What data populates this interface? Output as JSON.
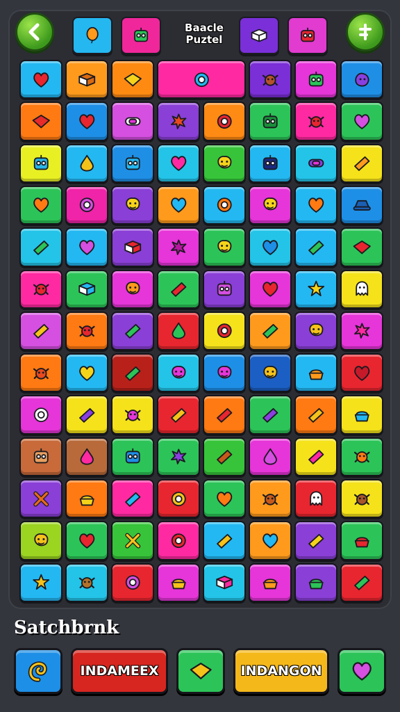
{
  "header": {
    "title_line1": "Baacle",
    "title_line2": "Puztel",
    "back_icon": "back-arrow-icon",
    "menu_icon": "cross-menu-icon",
    "top_tiles": [
      {
        "color": "#25b7f0",
        "icon": "balloon"
      },
      {
        "color": "#f0279a",
        "icon": "robot"
      },
      {
        "color": "#7a2fd8",
        "icon": "book"
      },
      {
        "color": "#e13bd0",
        "icon": "robot"
      }
    ]
  },
  "board": {
    "tiles": [
      {
        "color": "#23b8f2",
        "icon": "heart",
        "fill": "#e8262f"
      },
      {
        "color": "#ff9a1c",
        "icon": "book",
        "fill": "#d86a12"
      },
      {
        "color": "#ff8a12",
        "icon": "diamond",
        "fill": "#f5d31a"
      },
      {
        "color": "#ff2aa1",
        "icon": "ring",
        "fill": "#23b8f2",
        "wide": true
      },
      {
        "color": "#7b2fd6",
        "icon": "crab",
        "fill": "#b5522c"
      },
      {
        "color": "#e635d8",
        "icon": "robot",
        "fill": "#2cc458"
      },
      {
        "color": "#1f8fe6",
        "icon": "blob",
        "fill": "#8a3fe0"
      },
      {
        "color": "#ff7a12",
        "icon": "diamond",
        "fill": "#e82a2a"
      },
      {
        "color": "#1e8fe6",
        "icon": "heart",
        "fill": "#e8262f"
      },
      {
        "color": "#d54fe0",
        "icon": "candy",
        "fill": "#ffffff"
      },
      {
        "color": "#8a3fd6",
        "icon": "flower",
        "fill": "#e84a1e"
      },
      {
        "color": "#ff8a14",
        "icon": "ring",
        "fill": "#e8262f"
      },
      {
        "color": "#2cc458",
        "icon": "robot",
        "fill": "#1a8f3a"
      },
      {
        "color": "#ff2aa1",
        "icon": "crab",
        "fill": "#e8262f"
      },
      {
        "color": "#2cc458",
        "icon": "heart",
        "fill": "#d54fe0"
      },
      {
        "color": "#e8f024",
        "icon": "robot",
        "fill": "#29b6e8"
      },
      {
        "color": "#23b8f2",
        "icon": "drop",
        "fill": "#f5c21a"
      },
      {
        "color": "#1f8fe6",
        "icon": "robot",
        "fill": "#23b8f2"
      },
      {
        "color": "#23c4e8",
        "icon": "heart",
        "fill": "#ff2aa1"
      },
      {
        "color": "#37c43a",
        "icon": "smile",
        "fill": "#f5d31a"
      },
      {
        "color": "#23b8f2",
        "icon": "robot",
        "fill": "#1a2a80"
      },
      {
        "color": "#23c4e8",
        "icon": "candy",
        "fill": "#8a3fe0"
      },
      {
        "color": "#f5e21a",
        "icon": "bar",
        "fill": "#ff9a1c"
      },
      {
        "color": "#2cc458",
        "icon": "heart",
        "fill": "#ff7a12"
      },
      {
        "color": "#f024a8",
        "icon": "ring",
        "fill": "#d54fe0"
      },
      {
        "color": "#8a3fd6",
        "icon": "smile",
        "fill": "#f5d31a"
      },
      {
        "color": "#ff9a1c",
        "icon": "heart",
        "fill": "#23b8f2"
      },
      {
        "color": "#23b8f2",
        "icon": "ring",
        "fill": "#ff7a12"
      },
      {
        "color": "#e635d8",
        "icon": "smile",
        "fill": "#f5d31a"
      },
      {
        "color": "#23b8f2",
        "icon": "heart",
        "fill": "#ff7a12"
      },
      {
        "color": "#1e8fe6",
        "icon": "hat",
        "fill": "#1a5fb4"
      },
      {
        "color": "#23c4e8",
        "icon": "bar",
        "fill": "#2cc458"
      },
      {
        "color": "#23b8f2",
        "icon": "heart",
        "fill": "#d54fe0"
      },
      {
        "color": "#8a3fd6",
        "icon": "book",
        "fill": "#e8262f"
      },
      {
        "color": "#e635d8",
        "icon": "flower",
        "fill": "#b5179e"
      },
      {
        "color": "#2cc458",
        "icon": "smile",
        "fill": "#f5d31a"
      },
      {
        "color": "#23c4e8",
        "icon": "heart",
        "fill": "#1e8fe6"
      },
      {
        "color": "#23b8f2",
        "icon": "bar",
        "fill": "#2cc458"
      },
      {
        "color": "#2cc458",
        "icon": "diamond",
        "fill": "#e8262f"
      },
      {
        "color": "#ff2aa1",
        "icon": "crab",
        "fill": "#e8262f"
      },
      {
        "color": "#2cc458",
        "icon": "book",
        "fill": "#23b8f2"
      },
      {
        "color": "#e635d8",
        "icon": "smile",
        "fill": "#ff9a1c"
      },
      {
        "color": "#2cc458",
        "icon": "bar",
        "fill": "#e8262f"
      },
      {
        "color": "#8a3fd6",
        "icon": "robot",
        "fill": "#d54fe0"
      },
      {
        "color": "#e635d8",
        "icon": "heart",
        "fill": "#e8262f"
      },
      {
        "color": "#23b8f2",
        "icon": "star",
        "fill": "#f5d31a"
      },
      {
        "color": "#f5e21a",
        "icon": "ghost",
        "fill": "#ffffff"
      },
      {
        "color": "#d54fe0",
        "icon": "bar",
        "fill": "#f5c21a"
      },
      {
        "color": "#ff7a12",
        "icon": "crab",
        "fill": "#e8262f"
      },
      {
        "color": "#8a3fd6",
        "icon": "bar",
        "fill": "#2cc458"
      },
      {
        "color": "#e8262f",
        "icon": "drop",
        "fill": "#2cc458"
      },
      {
        "color": "#f5e21a",
        "icon": "ring",
        "fill": "#e8262f"
      },
      {
        "color": "#ff9a1c",
        "icon": "bar",
        "fill": "#2cc458"
      },
      {
        "color": "#8a3fd6",
        "icon": "smile",
        "fill": "#f5c21a"
      },
      {
        "color": "#e635d8",
        "icon": "flower",
        "fill": "#ff2aa1"
      },
      {
        "color": "#ff7a12",
        "icon": "crab",
        "fill": "#e84a1e"
      },
      {
        "color": "#23b8f2",
        "icon": "heart",
        "fill": "#f5d31a"
      },
      {
        "color": "#b8211a",
        "icon": "bar",
        "fill": "#2cc458"
      },
      {
        "color": "#23c4e8",
        "icon": "smile",
        "fill": "#e635d8"
      },
      {
        "color": "#1e8fe6",
        "icon": "smile",
        "fill": "#e635d8"
      },
      {
        "color": "#1b5fc4",
        "icon": "smile",
        "fill": "#f5c21a"
      },
      {
        "color": "#23b8f2",
        "icon": "cup",
        "fill": "#ff9a1c"
      },
      {
        "color": "#e8262f",
        "icon": "heart",
        "fill": "#c61a2a"
      },
      {
        "color": "#e635d8",
        "icon": "ring",
        "fill": "#ffffff"
      },
      {
        "color": "#f5e21a",
        "icon": "bar",
        "fill": "#8a3fe0"
      },
      {
        "color": "#f5e21a",
        "icon": "crab",
        "fill": "#e635d8"
      },
      {
        "color": "#e8262f",
        "icon": "bar",
        "fill": "#f5c21a"
      },
      {
        "color": "#ff7a12",
        "icon": "bar",
        "fill": "#e8262f"
      },
      {
        "color": "#2cc458",
        "icon": "bar",
        "fill": "#8a3fe0"
      },
      {
        "color": "#ff7a12",
        "icon": "bar",
        "fill": "#f5c21a"
      },
      {
        "color": "#f5e21a",
        "icon": "cup",
        "fill": "#23b8f2"
      },
      {
        "color": "#c86a3a",
        "icon": "robot",
        "fill": "#e8a060"
      },
      {
        "color": "#b86a3a",
        "icon": "drop",
        "fill": "#ff2aa1"
      },
      {
        "color": "#2cc458",
        "icon": "robot",
        "fill": "#1e8fe6"
      },
      {
        "color": "#2cc458",
        "icon": "flower",
        "fill": "#8a3fe0"
      },
      {
        "color": "#37c43a",
        "icon": "bar",
        "fill": "#c65a1a"
      },
      {
        "color": "#e635d8",
        "icon": "drop",
        "fill": "#d54fe0"
      },
      {
        "color": "#f5e21a",
        "icon": "bar",
        "fill": "#ff2aa1"
      },
      {
        "color": "#2cc458",
        "icon": "crab",
        "fill": "#ff7a12"
      },
      {
        "color": "#8a3fd6",
        "icon": "cross",
        "fill": "#e86a1a"
      },
      {
        "color": "#ff7a12",
        "icon": "cup",
        "fill": "#f5d31a"
      },
      {
        "color": "#ff2aa1",
        "icon": "bar",
        "fill": "#23b8f2"
      },
      {
        "color": "#e8262f",
        "icon": "ring",
        "fill": "#f5c21a"
      },
      {
        "color": "#2cc458",
        "icon": "heart",
        "fill": "#ff7a12"
      },
      {
        "color": "#ff9a1c",
        "icon": "crab",
        "fill": "#c65a1a"
      },
      {
        "color": "#e8262f",
        "icon": "ghost",
        "fill": "#ffffff"
      },
      {
        "color": "#f5e21a",
        "icon": "crab",
        "fill": "#a8562a"
      },
      {
        "color": "#9bd421",
        "icon": "smile",
        "fill": "#f5c21a"
      },
      {
        "color": "#2cc458",
        "icon": "heart",
        "fill": "#e8262f"
      },
      {
        "color": "#37c43a",
        "icon": "cross",
        "fill": "#f5c21a"
      },
      {
        "color": "#ff2aa1",
        "icon": "ring",
        "fill": "#e8262f"
      },
      {
        "color": "#23b8f2",
        "icon": "bar",
        "fill": "#f5c21a"
      },
      {
        "color": "#ff9a1c",
        "icon": "heart",
        "fill": "#23b8f2"
      },
      {
        "color": "#8a3fd6",
        "icon": "bar",
        "fill": "#f5d31a"
      },
      {
        "color": "#2cc458",
        "icon": "cup",
        "fill": "#e8262f"
      },
      {
        "color": "#23b8f2",
        "icon": "star",
        "fill": "#f5c21a"
      },
      {
        "color": "#23c4e8",
        "icon": "crab",
        "fill": "#b5722a"
      },
      {
        "color": "#e8262f",
        "icon": "ring",
        "fill": "#d54fe0"
      },
      {
        "color": "#e635d8",
        "icon": "cup",
        "fill": "#f5c21a"
      },
      {
        "color": "#23c4e8",
        "icon": "book",
        "fill": "#ff2aa1"
      },
      {
        "color": "#e635d8",
        "icon": "cup",
        "fill": "#ff9a1c"
      },
      {
        "color": "#8a3fd6",
        "icon": "cup",
        "fill": "#2cc458"
      },
      {
        "color": "#e8262f",
        "icon": "bar",
        "fill": "#2cc458"
      }
    ]
  },
  "footer": {
    "label": "Satchbrnk",
    "buttons": [
      {
        "kind": "square",
        "color": "#1e8fe6",
        "icon": "swirl",
        "fill": "#f5c21a"
      },
      {
        "kind": "wide",
        "color": "#d7261f",
        "label": "INDAMEEX"
      },
      {
        "kind": "square",
        "color": "#2cc458",
        "icon": "diamond",
        "fill": "#f5c21a"
      },
      {
        "kind": "wide",
        "color": "#f5b81a",
        "label": "INDANGON"
      },
      {
        "kind": "square",
        "color": "#2cc458",
        "icon": "heart",
        "fill": "#d54fe0"
      }
    ]
  }
}
